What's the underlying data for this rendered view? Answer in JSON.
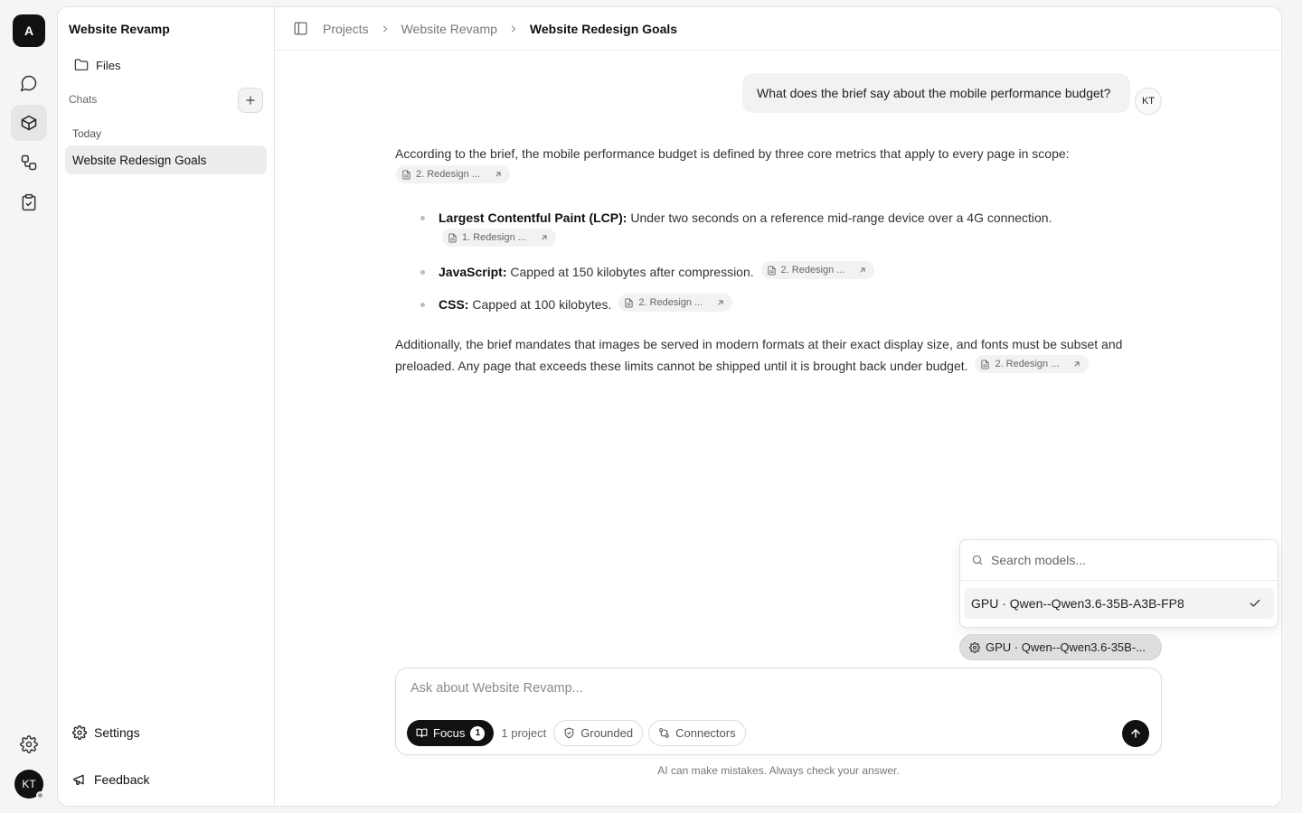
{
  "app": {
    "logo_letter": "A",
    "user_initials": "KT"
  },
  "rail": {
    "items": [
      {
        "name": "chat",
        "icon": "message-circle-icon"
      },
      {
        "name": "projects",
        "icon": "cube-icon",
        "active": true
      },
      {
        "name": "workflows",
        "icon": "workflow-icon"
      },
      {
        "name": "tasks",
        "icon": "clipboard-check-icon"
      }
    ],
    "settings_icon": "gear-icon"
  },
  "sidebar": {
    "project_title": "Website Revamp",
    "files_label": "Files",
    "chats_label": "Chats",
    "today_label": "Today",
    "chats": [
      {
        "title": "Website Redesign Goals",
        "active": true
      }
    ],
    "settings_label": "Settings",
    "feedback_label": "Feedback"
  },
  "header": {
    "breadcrumb": [
      "Projects",
      "Website Revamp",
      "Website Redesign Goals"
    ]
  },
  "conversation": {
    "user_message": "What does the brief say about the mobile performance budget?",
    "answer": {
      "intro": "According to the brief, the mobile performance budget is defined by three core metrics that apply to every page in scope:",
      "intro_citation": "2. Redesign ...",
      "bullets": [
        {
          "label": "Largest Contentful Paint (LCP):",
          "text": "Under two seconds on a reference mid-range device over a 4G connection.",
          "citation": "1. Redesign ..."
        },
        {
          "label": "JavaScript:",
          "text": "Capped at 150 kilobytes after compression.",
          "citation": "2. Redesign ..."
        },
        {
          "label": "CSS:",
          "text": "Capped at 100 kilobytes.",
          "citation": "2. Redesign ..."
        }
      ],
      "closing": "Additionally, the brief mandates that images be served in modern formats at their exact display size, and fonts must be subset and preloaded. Any page that exceeds these limits cannot be shipped until it is brought back under budget.",
      "closing_citation": "2. Redesign ..."
    }
  },
  "model_picker": {
    "search_placeholder": "Search models...",
    "options": [
      {
        "label": "GPU · Qwen--Qwen3.6-35B-A3B-FP8",
        "selected": true
      }
    ],
    "chip_label": "GPU · Qwen--Qwen3.6-35B-..."
  },
  "composer": {
    "placeholder": "Ask about Website Revamp...",
    "focus_label": "Focus",
    "focus_count": "1",
    "project_count": "1 project",
    "grounded_label": "Grounded",
    "connectors_label": "Connectors",
    "disclaimer": "AI can make mistakes. Always check your answer."
  },
  "colors": {
    "accent": "#111111",
    "background": "#f5f5f5",
    "surface": "#ffffff",
    "active_item": "#ededed"
  }
}
